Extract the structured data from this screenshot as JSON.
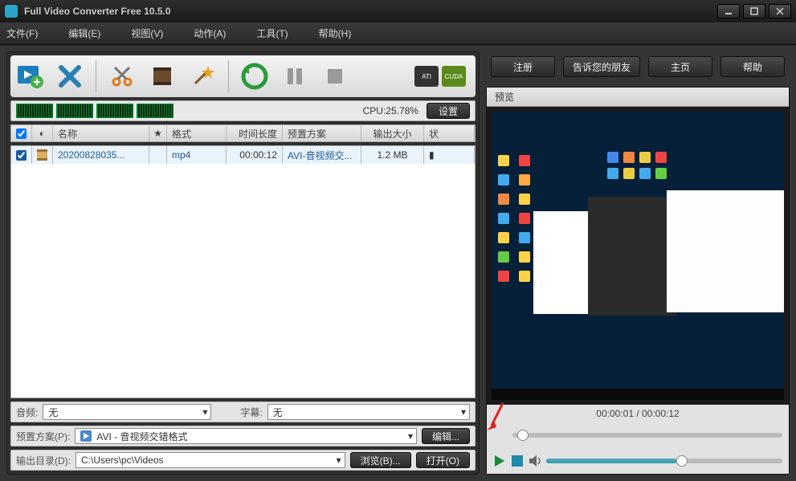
{
  "app": {
    "title": "Full Video Converter Free 10.5.0"
  },
  "menu": {
    "file": "文件(F)",
    "edit": "编辑(E)",
    "view": "视图(V)",
    "action": "动作(A)",
    "tools": "工具(T)",
    "help": "帮助(H)"
  },
  "badges": {
    "ati": "ATI",
    "cuda": "CUDA"
  },
  "cpu": {
    "label_prefix": "CPU:",
    "percent": "25.78%",
    "settings_btn": "设置"
  },
  "columns": {
    "name": "名称",
    "format": "格式",
    "duration": "时间长度",
    "preset": "预置方案",
    "outsize": "输出大小",
    "status": "状"
  },
  "row0": {
    "name": "20200828035...",
    "format": "mp4",
    "duration": "00:00:12",
    "preset": "AVI-音视频交...",
    "outsize": "1.2 MB"
  },
  "audio": {
    "label": "音频:",
    "value": "无"
  },
  "subtitle": {
    "label": "字幕:",
    "value": "无"
  },
  "preset_row": {
    "label": "预置方案(P):",
    "value": "AVI - 音视频交错格式",
    "edit_btn": "编辑..."
  },
  "outdir": {
    "label": "输出目录(D):",
    "value": "C:\\Users\\pc\\Videos",
    "browse_btn": "浏览(B)...",
    "open_btn": "打开(O)"
  },
  "actions": {
    "register": "注册",
    "tell": "告诉您的朋友",
    "home": "主页",
    "help": "帮助"
  },
  "preview": {
    "title": "预览",
    "time": "00:00:01 / 00:00:12"
  },
  "icons": {
    "add": "add-video-icon",
    "remove": "remove-icon",
    "cut": "scissors-icon",
    "filmstrip": "filmstrip-icon",
    "wand": "wand-icon",
    "convert": "convert-icon",
    "pause": "pause-icon",
    "stop": "stop-icon"
  }
}
